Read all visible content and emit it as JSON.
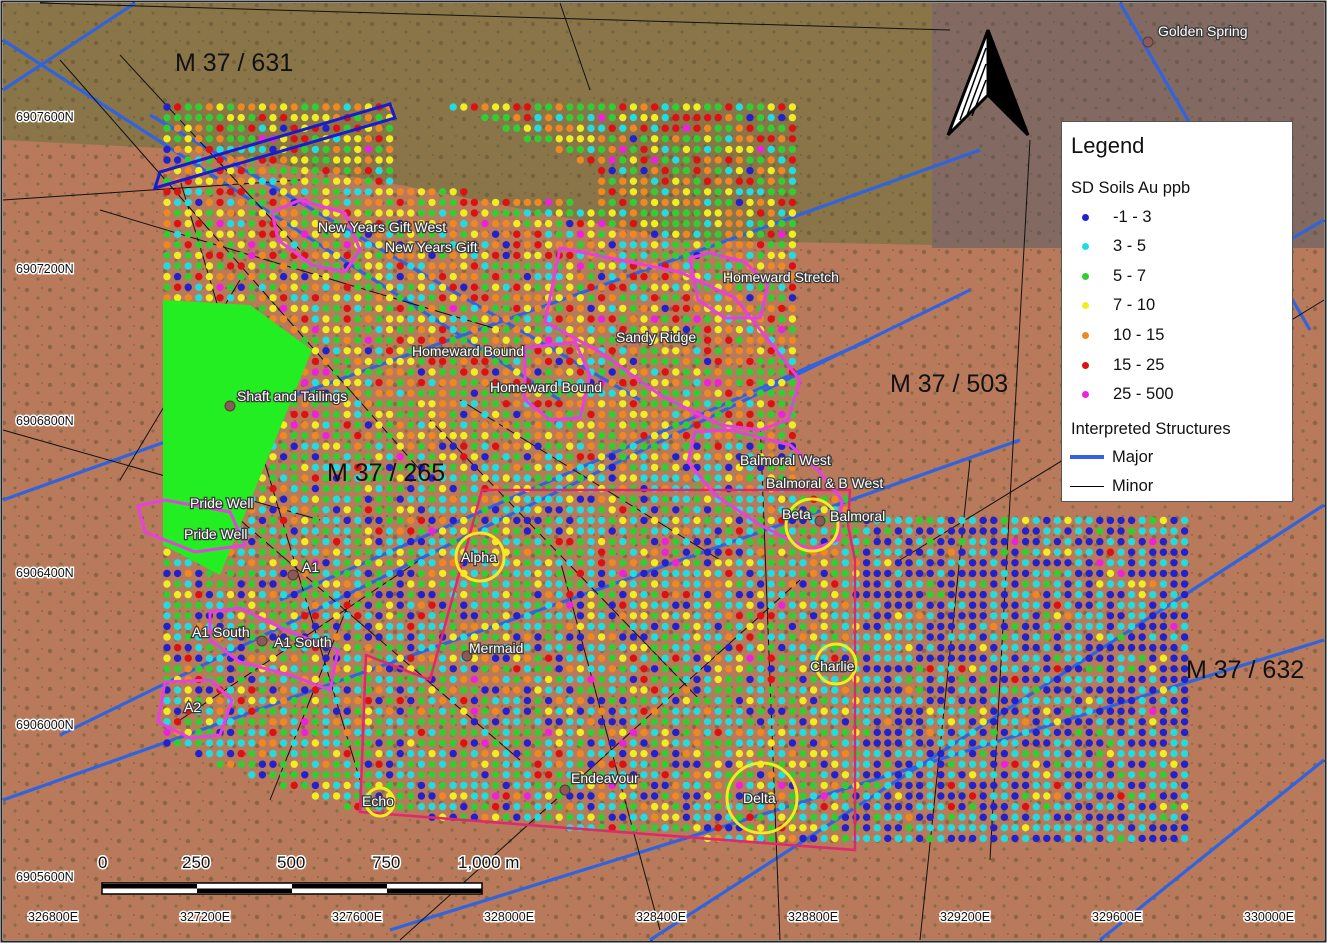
{
  "tenements": [
    "M 37 / 631",
    "M 37 / 503",
    "M 37 / 265",
    "M 37 / 632"
  ],
  "place_labels": {
    "golden_spring": "Golden Spring",
    "nyg_west": "New Years Gift West",
    "nyg": "New Years Gift",
    "homeward_stretch": "Homeward Stretch",
    "sandy_ridge": "Sandy Ridge",
    "homeward_bound_1": "Homeward Bound",
    "homeward_bound_2": "Homeward Bound",
    "shaft": "Shaft and Tailings",
    "balmoral_west": "Balmoral West",
    "balmoral_bwest": "Balmoral & B West",
    "beta": "Beta",
    "balmoral": "Balmoral",
    "pride_well_1": "Pride Well",
    "pride_well_2": "Pride Well",
    "a1": "A1",
    "alpha": "Alpha",
    "a1_south_1": "A1 South",
    "a1_south_2": "A1 South",
    "mermaid": "Mermaid",
    "charlie": "Charlie",
    "a2": "A2",
    "endeavour": "Endeavour",
    "echo": "Echo",
    "delta": "Delta"
  },
  "northings": [
    "6907600N",
    "6907200N",
    "6906800N",
    "6906400N",
    "6906000N",
    "6905600N"
  ],
  "eastings": [
    "326800E",
    "327200E",
    "327600E",
    "328000E",
    "328400E",
    "328800E",
    "329200E",
    "329600E",
    "330000E"
  ],
  "scale_bar": {
    "labels": [
      "0",
      "250",
      "500",
      "750",
      "1,000 m"
    ]
  },
  "legend": {
    "title": "Legend",
    "soils_title": "SD Soils Au ppb",
    "classes": [
      {
        "label": "-1 - 3",
        "color": "#2222cc"
      },
      {
        "label": "3 - 5",
        "color": "#22dddd"
      },
      {
        "label": "5 - 7",
        "color": "#33cc33"
      },
      {
        "label": "7 - 10",
        "color": "#eeee22"
      },
      {
        "label": "10 - 15",
        "color": "#ee8822"
      },
      {
        "label": "15 - 25",
        "color": "#dd1111"
      },
      {
        "label": "25 - 500",
        "color": "#ee22dd"
      }
    ],
    "structures_title": "Interpreted Structures",
    "major_label": "Major",
    "minor_label": "Minor",
    "major_color": "#2f63e0",
    "minor_color": "#000000"
  }
}
